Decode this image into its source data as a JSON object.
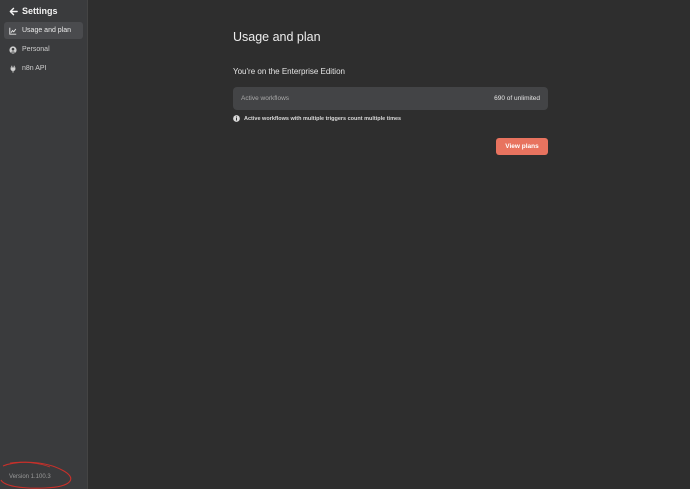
{
  "sidebar": {
    "header": {
      "title": "Settings"
    },
    "items": [
      {
        "label": "Usage and plan",
        "icon": "chart-icon",
        "active": true
      },
      {
        "label": "Personal",
        "icon": "user-circle-icon",
        "active": false
      },
      {
        "label": "n8n API",
        "icon": "plug-icon",
        "active": false
      }
    ],
    "version": "Version 1.100.3"
  },
  "main": {
    "title": "Usage and plan",
    "edition_text": "You're on the Enterprise Edition",
    "usage": {
      "label": "Active workflows",
      "value": "690 of unlimited"
    },
    "info_text": "Active workflows with multiple triggers count multiple times",
    "view_plans_label": "View plans"
  },
  "colors": {
    "background": "#2e2e2e",
    "sidebar": "#3a3b3d",
    "card": "#434446",
    "accent": "#e8735f",
    "annotation": "#c8302a"
  }
}
